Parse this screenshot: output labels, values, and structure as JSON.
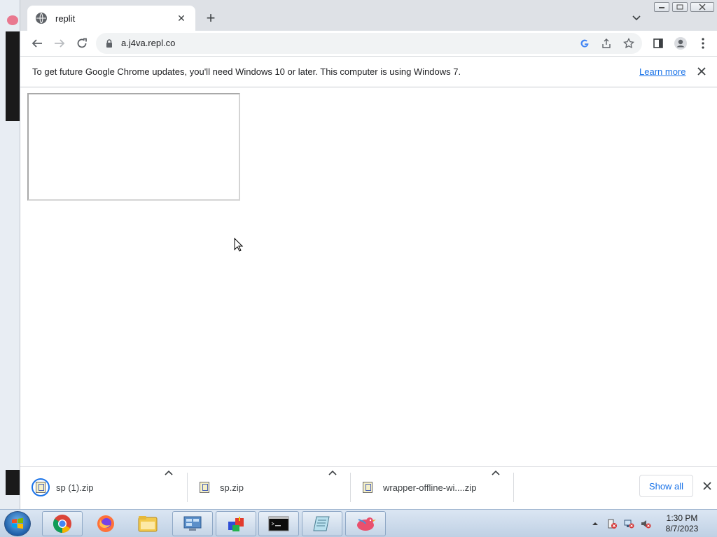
{
  "browser": {
    "tab": {
      "title": "replit",
      "icon": "globe-icon"
    },
    "address": {
      "url": "a.j4va.repl.co"
    },
    "infobar": {
      "message": "To get future Google Chrome updates, you'll need Windows 10 or later. This computer is using Windows 7.",
      "link_label": "Learn more"
    }
  },
  "downloads": {
    "items": [
      {
        "name": "sp (1).zip",
        "icon": "zip-file-icon"
      },
      {
        "name": "sp.zip",
        "icon": "zip-file-icon"
      },
      {
        "name": "wrapper-offline-wi....zip",
        "icon": "zip-file-icon"
      }
    ],
    "show_all_label": "Show all"
  },
  "taskbar": {
    "apps": [
      "chrome-icon",
      "firefox-icon",
      "file-explorer-icon",
      "control-panel-icon",
      "3d-builder-icon",
      "command-prompt-icon",
      "notepad-icon",
      "bird-app-icon"
    ],
    "clock": {
      "time": "1:30 PM",
      "date": "8/7/2023"
    }
  },
  "colors": {
    "accent": "#1a73e8",
    "titlebar": "#dee1e6",
    "taskbar": "#c9d8ea"
  }
}
